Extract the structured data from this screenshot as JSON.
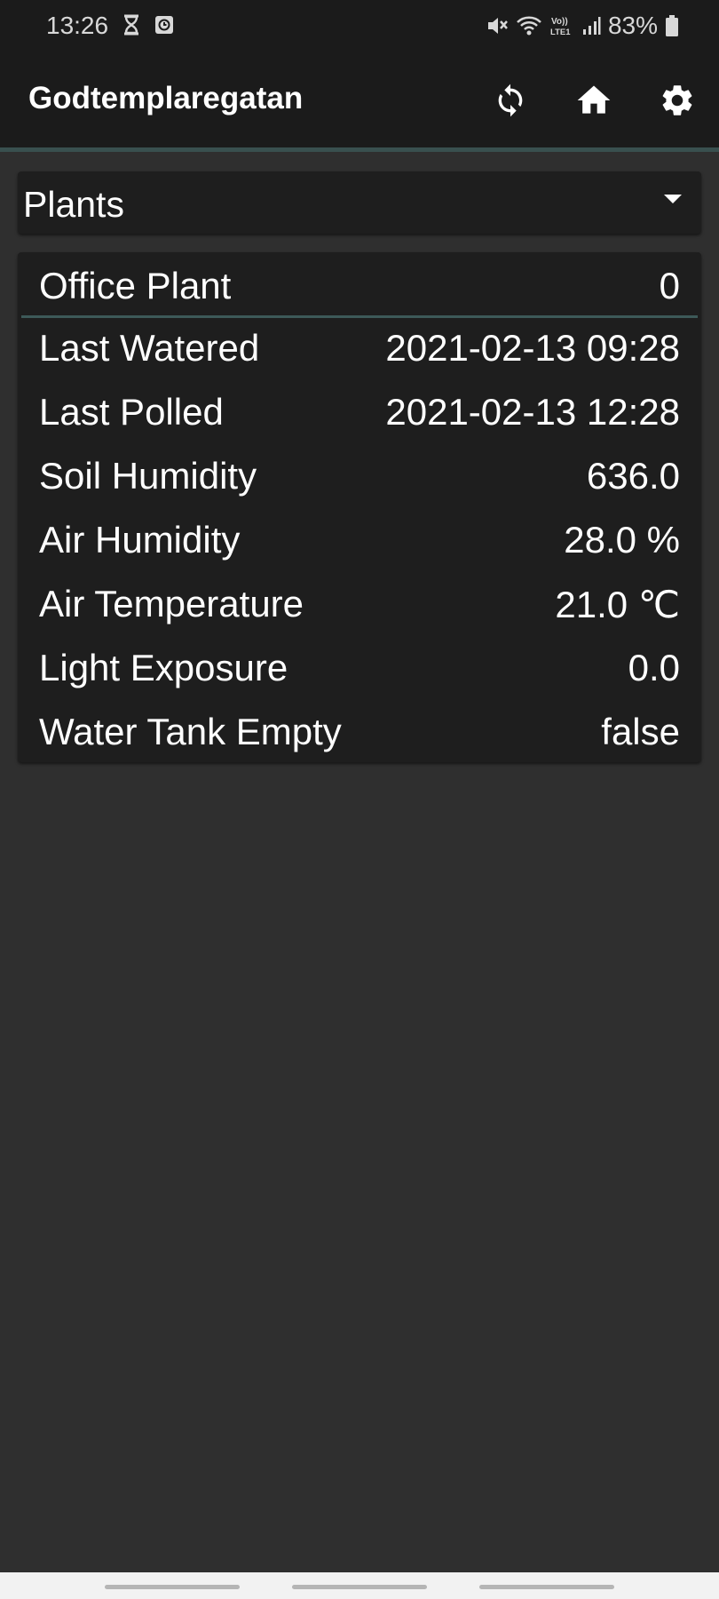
{
  "status_bar": {
    "time": "13:26",
    "left_icons": [
      "hourglass-icon",
      "clock-app-icon"
    ],
    "right_icons": [
      "mute-icon",
      "wifi-icon",
      "volte-lte-icon",
      "signal-icon"
    ],
    "battery_text": "83%"
  },
  "app_bar": {
    "title": "Godtemplaregatan",
    "actions": [
      "sync-icon",
      "home-icon",
      "settings-icon"
    ]
  },
  "dropdown": {
    "selected": "Plants"
  },
  "plant_card": {
    "name": "Office Plant",
    "count": "0",
    "rows": [
      {
        "label": "Last Watered",
        "value": "2021-02-13 09:28"
      },
      {
        "label": "Last Polled",
        "value": "2021-02-13 12:28"
      },
      {
        "label": "Soil Humidity",
        "value": "636.0"
      },
      {
        "label": "Air Humidity",
        "value": "28.0 %"
      },
      {
        "label": "Air Temperature",
        "value": "21.0 ℃"
      },
      {
        "label": "Light Exposure",
        "value": "0.0"
      },
      {
        "label": "Water Tank Empty",
        "value": "false"
      }
    ]
  },
  "colors": {
    "background": "#2f2f2f",
    "app_bar": "#1b1b1b",
    "card": "#1e1e1e",
    "accent": "#3d5958",
    "text": "#ffffff"
  }
}
